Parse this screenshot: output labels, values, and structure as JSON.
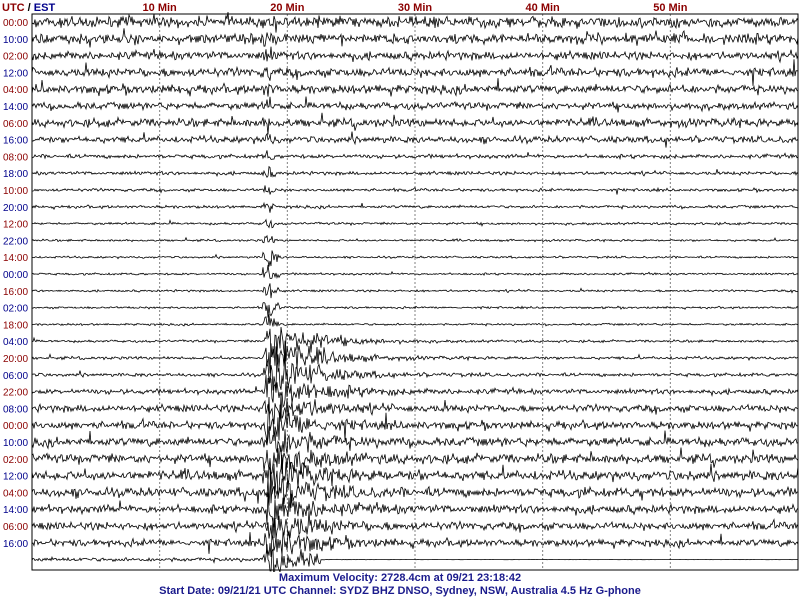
{
  "chart_data": {
    "type": "line",
    "title": "",
    "header_left": {
      "utc": "UTC",
      "sep": "/",
      "local": "EST"
    },
    "x_ticks": [
      {
        "value": 10,
        "label": "10 Min"
      },
      {
        "value": 20,
        "label": "20 Min"
      },
      {
        "value": 30,
        "label": "30 Min"
      },
      {
        "value": 40,
        "label": "40 Min"
      },
      {
        "value": 50,
        "label": "50 Min"
      }
    ],
    "xlim": [
      0,
      60
    ],
    "grid": true,
    "rows_count": 34,
    "rows_utc_labels": [
      {
        "row": 0,
        "label": "00:00"
      },
      {
        "row": 2,
        "label": "02:00"
      },
      {
        "row": 4,
        "label": "04:00"
      },
      {
        "row": 6,
        "label": "06:00"
      },
      {
        "row": 8,
        "label": "08:00"
      },
      {
        "row": 10,
        "label": "10:00"
      },
      {
        "row": 12,
        "label": "12:00"
      },
      {
        "row": 14,
        "label": "14:00"
      },
      {
        "row": 16,
        "label": "16:00"
      },
      {
        "row": 18,
        "label": "18:00"
      },
      {
        "row": 20,
        "label": "20:00"
      },
      {
        "row": 22,
        "label": "22:00"
      },
      {
        "row": 24,
        "label": "00:00"
      },
      {
        "row": 26,
        "label": "02:00"
      },
      {
        "row": 28,
        "label": "04:00"
      },
      {
        "row": 30,
        "label": "06:00"
      }
    ],
    "rows_local_labels": [
      {
        "row": 1,
        "label": "10:00"
      },
      {
        "row": 3,
        "label": "12:00"
      },
      {
        "row": 5,
        "label": "14:00"
      },
      {
        "row": 7,
        "label": "16:00"
      },
      {
        "row": 9,
        "label": "18:00"
      },
      {
        "row": 11,
        "label": "20:00"
      },
      {
        "row": 13,
        "label": "22:00"
      },
      {
        "row": 15,
        "label": "00:00"
      },
      {
        "row": 17,
        "label": "02:00"
      },
      {
        "row": 19,
        "label": "04:00"
      },
      {
        "row": 21,
        "label": "06:00"
      },
      {
        "row": 23,
        "label": "08:00"
      },
      {
        "row": 25,
        "label": "10:00"
      },
      {
        "row": 27,
        "label": "12:00"
      },
      {
        "row": 29,
        "label": "14:00"
      },
      {
        "row": 31,
        "label": "16:00"
      }
    ],
    "row_noise_level": [
      0.95,
      0.9,
      0.7,
      0.75,
      0.75,
      0.6,
      0.7,
      0.55,
      0.3,
      0.25,
      0.2,
      0.2,
      0.15,
      0.12,
      0.12,
      0.12,
      0.12,
      0.12,
      0.12,
      0.15,
      0.2,
      0.25,
      0.4,
      0.6,
      0.65,
      0.75,
      0.8,
      0.85,
      0.8,
      0.7,
      0.65,
      0.6,
      0.3,
      0.0
    ],
    "event": {
      "start_min": 18.5,
      "start_row": 0,
      "peak_row": 21,
      "end_row": 33,
      "description": "earthquake"
    },
    "colors": {
      "utc": "#8b0000",
      "local": "#00008b",
      "trace": "#000000",
      "grid": "#808080",
      "footer": "#1a1a8c"
    }
  },
  "footer": {
    "max_velocity": "Maximum Velocity: 2728.4cm at 09/21 23:18:42",
    "start_info": "Start Date: 09/21/21 UTC Channel: SYDZ  BHZ  DNSO, Sydney, NSW, Australia  4.5 Hz G-phone"
  }
}
